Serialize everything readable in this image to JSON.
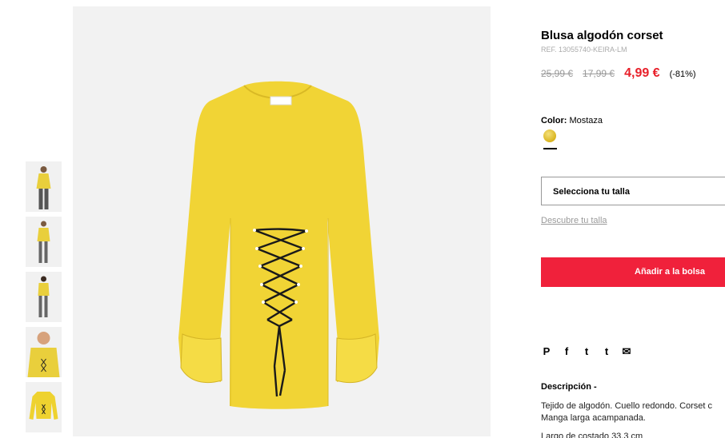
{
  "product": {
    "title": "Blusa algodón corset",
    "ref": "REF. 13055740-KEIRA-LM",
    "price_original": "25,99 €",
    "price_previous": "17,99 €",
    "price_current": "4,99 €",
    "discount": "(-81%)"
  },
  "color": {
    "label": "Color:",
    "value": "Mostaza",
    "swatch_hex": "#d9b41e"
  },
  "size": {
    "select_label": "Selecciona tu talla",
    "guide_link": "Descubre tu talla"
  },
  "actions": {
    "add_to_bag": "Añadir a la bolsa"
  },
  "social": {
    "icons": [
      "pinterest-icon",
      "facebook-icon",
      "twitter-icon",
      "tumblr-icon",
      "email-icon"
    ],
    "glyphs": [
      "P",
      "f",
      "t",
      "t",
      "✉"
    ]
  },
  "description": {
    "heading": "Descripción -",
    "line1": "Tejido de algodón. Cuello redondo. Corset c",
    "line2": "Manga larga acampanada.",
    "line3": "Largo de costado 33,3 cm"
  },
  "colors": {
    "accent": "#f0213b",
    "sale_price": "#e8202a",
    "blouse": "#f0d23a"
  }
}
